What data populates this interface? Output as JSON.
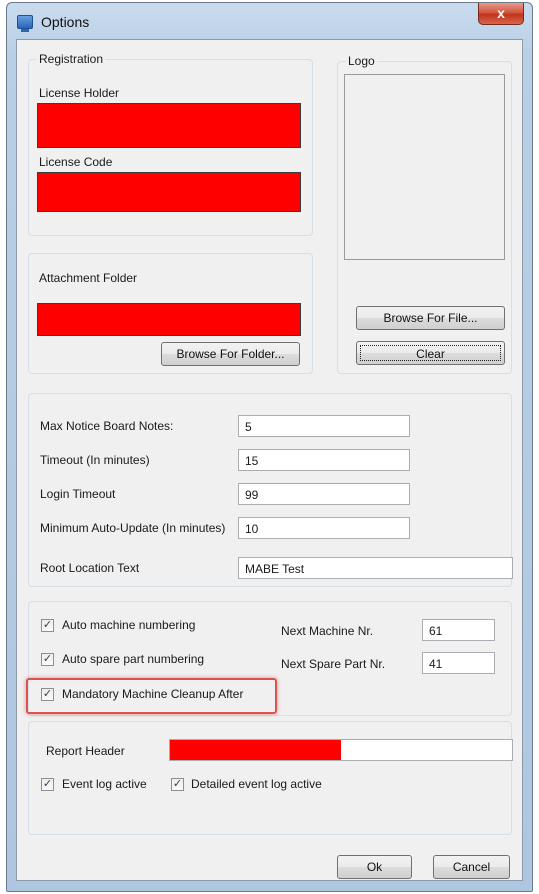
{
  "window": {
    "title": "Options",
    "close_glyph": "x"
  },
  "registration": {
    "group_title": "Registration",
    "license_holder_label": "License Holder",
    "license_code_label": "License Code"
  },
  "logo": {
    "group_title": "Logo",
    "browse_file_label": "Browse For File...",
    "clear_label": "Clear"
  },
  "attachment": {
    "label": "Attachment Folder",
    "browse_folder_label": "Browse For Folder..."
  },
  "settings": {
    "max_notes_label": "Max Notice Board Notes:",
    "max_notes_value": "5",
    "timeout_label": "Timeout (In minutes)",
    "timeout_value": "15",
    "login_timeout_label": "Login Timeout",
    "login_timeout_value": "99",
    "auto_update_label": "Minimum Auto-Update (In minutes)",
    "auto_update_value": "10",
    "root_location_label": "Root Location Text",
    "root_location_value": "MABE Test"
  },
  "numbering": {
    "auto_machine_label": "Auto machine numbering",
    "auto_machine_checked": true,
    "next_machine_label": "Next Machine Nr.",
    "next_machine_value": "61",
    "auto_spare_label": "Auto spare part numbering",
    "auto_spare_checked": true,
    "next_spare_label": "Next Spare Part Nr.",
    "next_spare_value": "41",
    "mandatory_cleanup_label": "Mandatory Machine Cleanup After",
    "mandatory_cleanup_checked": true
  },
  "report": {
    "header_label": "Report Header",
    "event_log_label": "Event log active",
    "event_log_checked": true,
    "detailed_log_label": "Detailed event log active",
    "detailed_log_checked": true
  },
  "footer": {
    "ok_label": "Ok",
    "cancel_label": "Cancel"
  },
  "icons": {
    "app": "options-window-icon",
    "check": "checkmark-icon"
  },
  "colors": {
    "redacted": "#ff0000",
    "highlight": "#d9534f"
  }
}
